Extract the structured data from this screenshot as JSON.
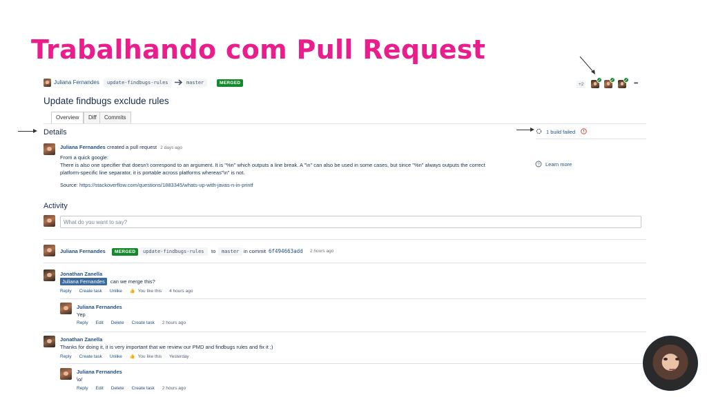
{
  "slide": {
    "title": "Trabalhando com Pull Request"
  },
  "pr": {
    "author": "Juliana Fernandes",
    "source_branch": "update-findbugs-rules",
    "target_branch": "master",
    "status": "MERGED",
    "title": "Update findbugs exclude rules",
    "reviewer_extra": "+2",
    "more": "•••"
  },
  "tabs": [
    {
      "label": "Overview"
    },
    {
      "label": "Diff"
    },
    {
      "label": "Commits"
    }
  ],
  "details": {
    "heading": "Details",
    "build": "1 build failed",
    "learn_more": "Learn more",
    "created_by": "Juliana Fernandes",
    "created_text": "created a pull request",
    "created_time": "2 days ago",
    "desc_line1": "From a quick google:",
    "desc_line2": "There is also one specifier that doesn't correspond to an argument. It is \"%n\" which outputs a line break. A \"\\n\" can also be used in some cases, but since \"%n\" always outputs the correct",
    "desc_line3": "platform-specific line separator, it is portable across platforms whereas\"\\n\" is not.",
    "source_label": "Source:",
    "source_url": "https://stackoverflow.com/questions/1883345/whats-up-with-javas-n-in-printf"
  },
  "activity": {
    "heading": "Activity",
    "placeholder": "What do you want to say?",
    "merge_event": {
      "author": "Juliana Fernandes",
      "badge": "MERGED",
      "branch": "update-findbugs-rules",
      "to": "to",
      "target": "master",
      "in_commit": "in commit",
      "commit": "6f494663add",
      "time": "2 hours ago"
    },
    "comments": [
      {
        "author": "Jonathan Zanella",
        "mention": "Juliana Fernandes",
        "text": "can we merge this?",
        "actions": {
          "reply": "Reply",
          "create_task": "Create task",
          "unlike": "Unlike",
          "like_text": "You like this",
          "time": "4 hours ago"
        },
        "reply": {
          "author": "Juliana Fernandes",
          "text": "Yep",
          "actions": {
            "reply": "Reply",
            "edit": "Edit",
            "delete": "Delete",
            "create_task": "Create task",
            "time": "2 hours ago"
          }
        }
      },
      {
        "author": "Jonathan Zanella",
        "text": "Thanks for doing it, it is very important that we review our PMD and findbugs rules and fix it ;)",
        "actions": {
          "reply": "Reply",
          "create_task": "Create task",
          "unlike": "Unlike",
          "like_text": "You like this",
          "time": "Yesterday"
        },
        "reply": {
          "author": "Juliana Fernandes",
          "text": "\\o/",
          "actions": {
            "reply": "Reply",
            "edit": "Edit",
            "delete": "Delete",
            "create_task": "Create task",
            "time": "2 hours ago"
          }
        }
      }
    ]
  },
  "colors": {
    "title": "#e91e8c",
    "merged": "#14892c",
    "link": "#205081",
    "error": "#d04437"
  },
  "icons": [
    "arrow-right-icon",
    "build-status-icon",
    "error-icon",
    "help-icon",
    "thumbs-up-icon",
    "approved-check-icon",
    "arrow-pointer-icon"
  ]
}
